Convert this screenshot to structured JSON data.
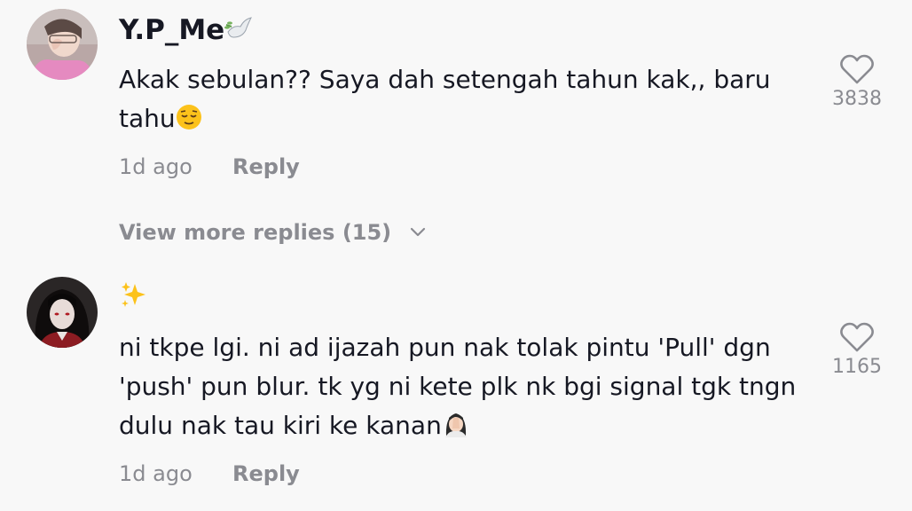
{
  "comments": [
    {
      "username": "Y.P_Me",
      "username_emoji": "dove-emoji",
      "text_lines": [
        "Akak sebulan?? Saya dah setengah tahun kak,, baru",
        "tahu"
      ],
      "trailing_emoji": "relieved-face-emoji",
      "time": "1d ago",
      "reply_label": "Reply",
      "likes": "3838",
      "view_more": "View more replies (15)"
    },
    {
      "username": "",
      "username_emoji": "sparkles-emoji",
      "text_lines": [
        "ni tkpe lgi. ni ad ijazah pun nak tolak pintu 'Pull' dgn",
        "'push' pun blur. tk yg ni kete plk nk bgi signal tgk tngn",
        "dulu nak tau kiri ke kanan"
      ],
      "trailing_emoji": "woman-facepalming-emoji",
      "time": "1d ago",
      "reply_label": "Reply",
      "likes": "1165"
    }
  ],
  "colors": {
    "background": "#f8f8f8",
    "primary_text": "#161823",
    "secondary_text": "#8a8b91"
  }
}
